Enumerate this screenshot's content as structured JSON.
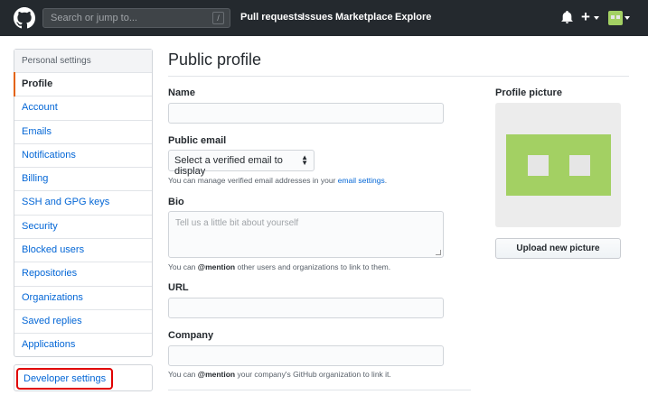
{
  "header": {
    "search_placeholder": "Search or jump to...",
    "search_shortcut": "/",
    "nav": [
      "Pull requests",
      "Issues",
      "Marketplace",
      "Explore"
    ],
    "plus_label": "+"
  },
  "sidebar": {
    "heading": "Personal settings",
    "items": [
      {
        "label": "Profile",
        "selected": true
      },
      {
        "label": "Account"
      },
      {
        "label": "Emails"
      },
      {
        "label": "Notifications"
      },
      {
        "label": "Billing"
      },
      {
        "label": "SSH and GPG keys"
      },
      {
        "label": "Security"
      },
      {
        "label": "Blocked users"
      },
      {
        "label": "Repositories"
      },
      {
        "label": "Organizations"
      },
      {
        "label": "Saved replies"
      },
      {
        "label": "Applications"
      }
    ],
    "developer_settings": "Developer settings"
  },
  "main": {
    "title": "Public profile",
    "name_label": "Name",
    "public_email_label": "Public email",
    "email_select_value": "Select a verified email to display",
    "email_note_prefix": "You can manage verified email addresses in your ",
    "email_note_link": "email settings",
    "email_note_suffix": ".",
    "bio_label": "Bio",
    "bio_placeholder": "Tell us a little bit about yourself",
    "bio_note_prefix": "You can ",
    "bio_note_mention": "@mention",
    "bio_note_suffix": " other users and organizations to link to them.",
    "url_label": "URL",
    "company_label": "Company",
    "company_note_prefix": "You can ",
    "company_note_mention": "@mention",
    "company_note_suffix": " your company's GitHub organization to link it."
  },
  "profile_picture": {
    "label": "Profile picture",
    "upload_button": "Upload new picture",
    "identicon_color": "#a3d063"
  },
  "colors": {
    "header_bg": "#24292e",
    "link": "#0366d6",
    "selected_marker": "#e36209",
    "highlight_box": "#e00000"
  }
}
